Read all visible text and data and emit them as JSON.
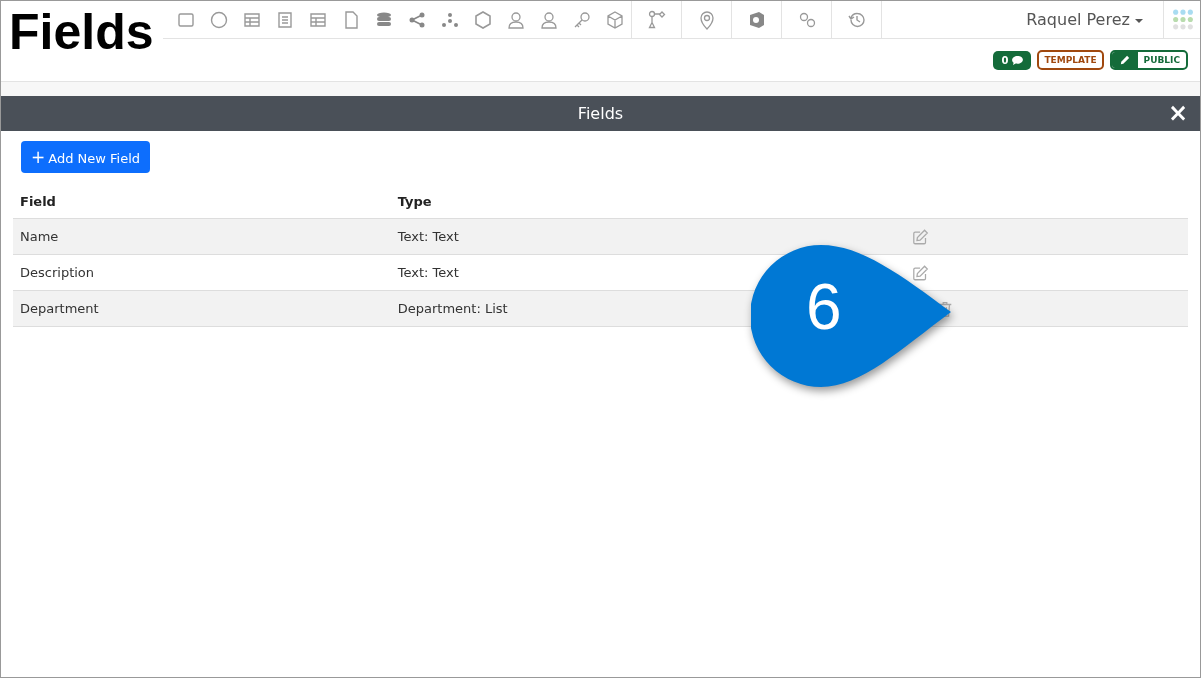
{
  "page_title": "Fields",
  "user": {
    "name": "Raquel Perez"
  },
  "badges": {
    "comments": "0",
    "template": "TEMPLATE",
    "public": "PUBLIC"
  },
  "panel": {
    "title": "Fields",
    "close": "×"
  },
  "add_button": {
    "label": "Add New Field",
    "icon": "+"
  },
  "table": {
    "columns": [
      "Field",
      "Type"
    ],
    "rows": [
      {
        "field": "Name",
        "type": "Text: Text",
        "deletable": false
      },
      {
        "field": "Description",
        "type": "Text: Text",
        "deletable": false
      },
      {
        "field": "Department",
        "type": "Department: List",
        "deletable": true
      }
    ]
  },
  "callout": {
    "number": "6"
  }
}
